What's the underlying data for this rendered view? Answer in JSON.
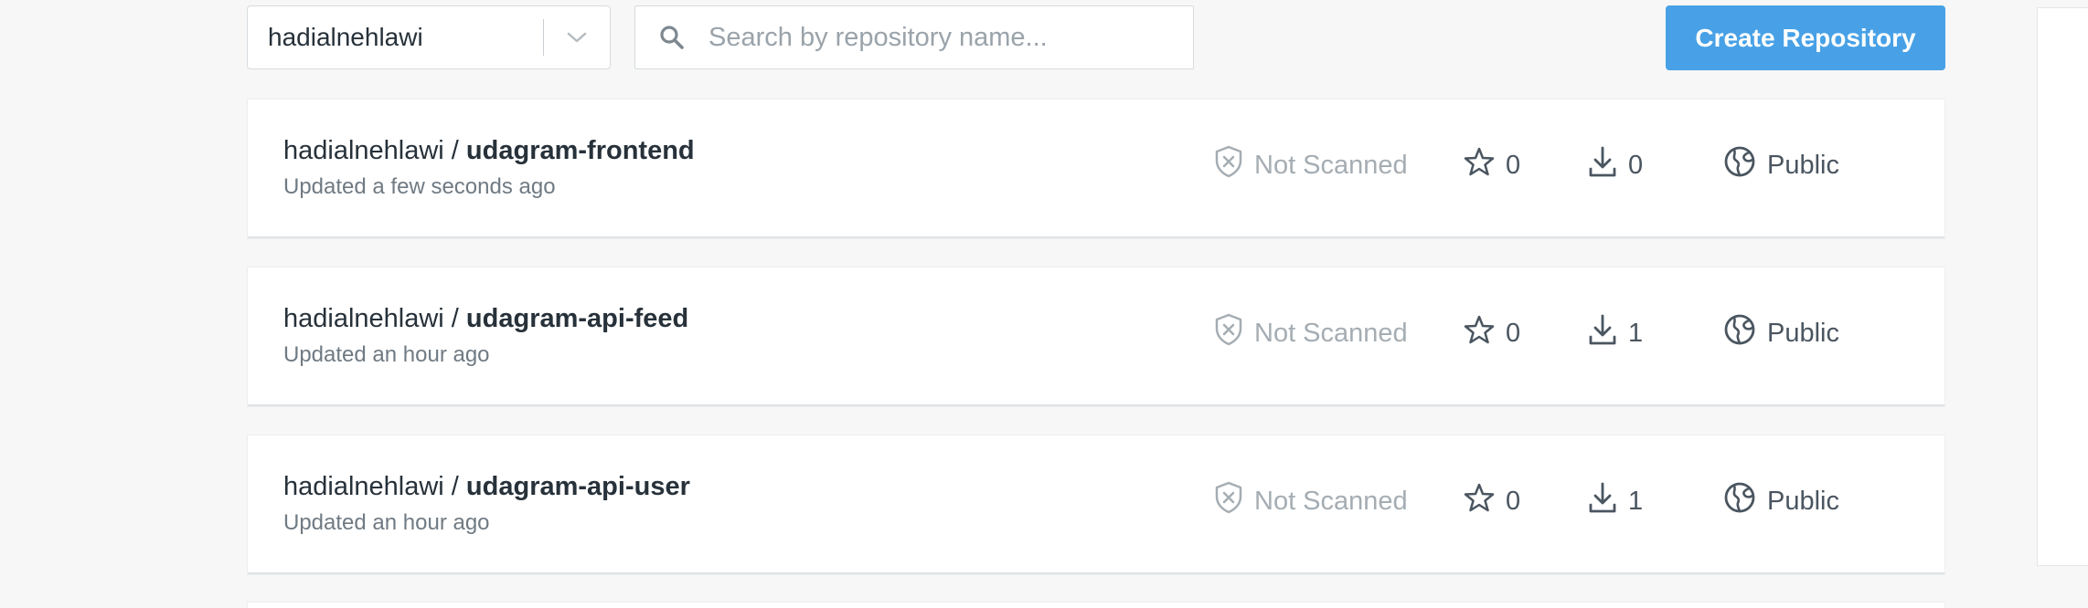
{
  "toolbar": {
    "namespace": "hadialnehlawi",
    "search_placeholder": "Search by repository name...",
    "create_label": "Create Repository"
  },
  "repositories": [
    {
      "namespace": "hadialnehlawi / ",
      "name": "udagram-frontend",
      "updated": "Updated a few seconds ago",
      "scan_status": "Not Scanned",
      "stars": "0",
      "pulls": "0",
      "visibility": "Public"
    },
    {
      "namespace": "hadialnehlawi / ",
      "name": "udagram-api-feed",
      "updated": "Updated an hour ago",
      "scan_status": "Not Scanned",
      "stars": "0",
      "pulls": "1",
      "visibility": "Public"
    },
    {
      "namespace": "hadialnehlawi / ",
      "name": "udagram-api-user",
      "updated": "Updated an hour ago",
      "scan_status": "Not Scanned",
      "stars": "0",
      "pulls": "1",
      "visibility": "Public"
    }
  ],
  "colors": {
    "accent": "#48a1e6",
    "background": "#f7f7f7",
    "muted": "#a5adb3"
  },
  "icons": {
    "search": "search-icon",
    "dropdown": "chevron-down-icon",
    "scan": "shield-x-icon",
    "star": "star-icon",
    "download": "download-icon",
    "public": "globe-icon"
  }
}
